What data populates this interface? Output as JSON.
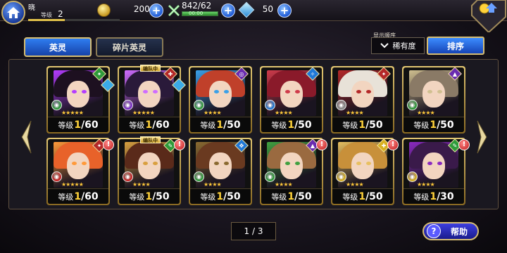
{
  "player": {
    "name": "晓",
    "level_label": "等级",
    "level": "2",
    "xp_fraction": 0.4
  },
  "resources": {
    "gold": "20000",
    "stamina": "842/62",
    "stamina_timer": "00:00",
    "stamina_fraction": 1.0,
    "gems": "50"
  },
  "menu": {
    "label": "菜单"
  },
  "tabs": [
    {
      "label": "英灵",
      "active": true
    },
    {
      "label": "碎片英灵",
      "active": false
    }
  ],
  "sort": {
    "caption": "显示顺序",
    "current": "稀有度",
    "button": "排序"
  },
  "party_label": "编队中",
  "level_label": "等级",
  "cards": [
    {
      "cur": "1",
      "max": "/60",
      "rarity": 5,
      "elem": "wind",
      "elem_color": "#2e9b3a",
      "badge_color": "#2e9b3a",
      "badge_glyph": "✦",
      "party": false,
      "alert": false,
      "hair": "#1d1020",
      "accent": "#b43cff",
      "book": "#3aaae8"
    },
    {
      "cur": "1",
      "max": "/60",
      "rarity": 5,
      "elem": "dark",
      "elem_color": "#7a2cc8",
      "badge_color": "#b42828",
      "badge_glyph": "✚",
      "party": true,
      "alert": false,
      "hair": "#2a1a3a",
      "accent": "#cf6cff",
      "book": "#3aaae8"
    },
    {
      "cur": "1",
      "max": "/50",
      "rarity": 4,
      "elem": "wind",
      "elem_color": "#2e9b3a",
      "badge_color": "#6a2cb0",
      "badge_glyph": "◎",
      "party": false,
      "alert": false,
      "hair": "#c0402a",
      "accent": "#3aa0e8",
      "book": ""
    },
    {
      "cur": "1",
      "max": "/50",
      "rarity": 4,
      "elem": "water",
      "elem_color": "#1f78d8",
      "badge_color": "#1f78d8",
      "badge_glyph": "✧",
      "party": false,
      "alert": false,
      "hair": "#8a1a2a",
      "accent": "#cf3a4a",
      "book": ""
    },
    {
      "cur": "1",
      "max": "/50",
      "rarity": 4,
      "elem": "light",
      "elem_color": "#8a8a8a",
      "badge_color": "#b42828",
      "badge_glyph": "✦",
      "party": false,
      "alert": false,
      "hair": "#e8e2d8",
      "accent": "#b42828",
      "book": ""
    },
    {
      "cur": "1",
      "max": "/50",
      "rarity": 4,
      "elem": "wind",
      "elem_color": "#2e9b3a",
      "badge_color": "#6a2cb0",
      "badge_glyph": "▲",
      "party": false,
      "alert": false,
      "hair": "#8a7a66",
      "accent": "#d0c090",
      "book": ""
    },
    {
      "cur": "1",
      "max": "/60",
      "rarity": 5,
      "elem": "fire",
      "elem_color": "#c82020",
      "badge_color": "#b42828",
      "badge_glyph": "✦",
      "party": false,
      "alert": true,
      "hair": "#e8622a",
      "accent": "#ff9a3a",
      "book": ""
    },
    {
      "cur": "1",
      "max": "/50",
      "rarity": 4,
      "elem": "fire",
      "elem_color": "#c82020",
      "badge_color": "#2e9b3a",
      "badge_glyph": "✎",
      "party": true,
      "alert": true,
      "hair": "#5a2a1a",
      "accent": "#d8a040",
      "book": ""
    },
    {
      "cur": "1",
      "max": "/50",
      "rarity": 4,
      "elem": "wind",
      "elem_color": "#2e9b3a",
      "badge_color": "#1f78d8",
      "badge_glyph": "✥",
      "party": false,
      "alert": false,
      "hair": "#6a3a20",
      "accent": "#8a6a30",
      "book": ""
    },
    {
      "cur": "1",
      "max": "/50",
      "rarity": 4,
      "elem": "wind",
      "elem_color": "#2e9b3a",
      "badge_color": "#6a2cb0",
      "badge_glyph": "▲",
      "party": false,
      "alert": true,
      "hair": "#9a6a40",
      "accent": "#40a040",
      "book": ""
    },
    {
      "cur": "1",
      "max": "/50",
      "rarity": 4,
      "elem": "light",
      "elem_color": "#d8b020",
      "badge_color": "#d8b020",
      "badge_glyph": "✚",
      "party": false,
      "alert": true,
      "hair": "#c8903a",
      "accent": "#e8c060",
      "book": ""
    },
    {
      "cur": "1",
      "max": "/30",
      "rarity": 4,
      "elem": "light",
      "elem_color": "#d8b020",
      "badge_color": "#2e9b3a",
      "badge_glyph": "✎",
      "party": false,
      "alert": true,
      "hair": "#3a1a4a",
      "accent": "#8a2ac0",
      "book": ""
    }
  ],
  "pager": {
    "text": "1 / 3"
  },
  "help": {
    "label": "帮助",
    "icon": "?"
  },
  "colors": {
    "accent_blue": "#2f7df0",
    "gold_border": "#d6bd72",
    "level_yellow": "#ffd23a"
  }
}
